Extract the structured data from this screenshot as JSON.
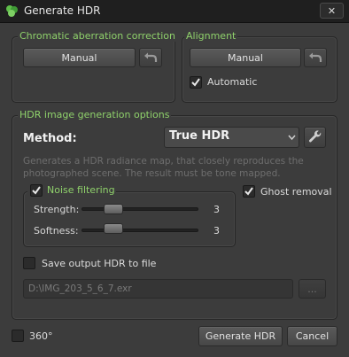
{
  "window": {
    "title": "Generate HDR",
    "close_label": "✕"
  },
  "chromatic": {
    "title": "Chromatic aberration correction",
    "button_label": "Manual"
  },
  "alignment": {
    "title": "Alignment",
    "button_label": "Manual",
    "automatic_label": "Automatic",
    "automatic_checked": true
  },
  "options": {
    "title": "HDR image generation options",
    "method_label": "Method:",
    "method_value": "True HDR",
    "description": "Generates a HDR radiance map, that closely reproduces the photographed scene. The result must be tone mapped.",
    "noise": {
      "title": "Noise filtering",
      "checked": true,
      "strength_label": "Strength:",
      "strength_value": "3",
      "softness_label": "Softness:",
      "softness_value": "3"
    },
    "ghost_label": "Ghost removal",
    "ghost_checked": true,
    "save_label": "Save output HDR to file",
    "save_checked": false,
    "path_value": "D:\\IMG_203_5_6_7.exr",
    "browse_label": "..."
  },
  "footer": {
    "label_360": "360°",
    "checked_360": false,
    "generate_label": "Generate HDR",
    "cancel_label": "Cancel"
  },
  "colors": {
    "accent_green": "#8fd16b",
    "background": "#3c3c3c",
    "titlebar": "#1f1f1f"
  },
  "icons": {
    "app": "app-green-icon",
    "undo": "undo-arrow-icon",
    "wrench": "wrench-icon",
    "check": "check-icon",
    "dropdown": "chevron-down-icon"
  }
}
